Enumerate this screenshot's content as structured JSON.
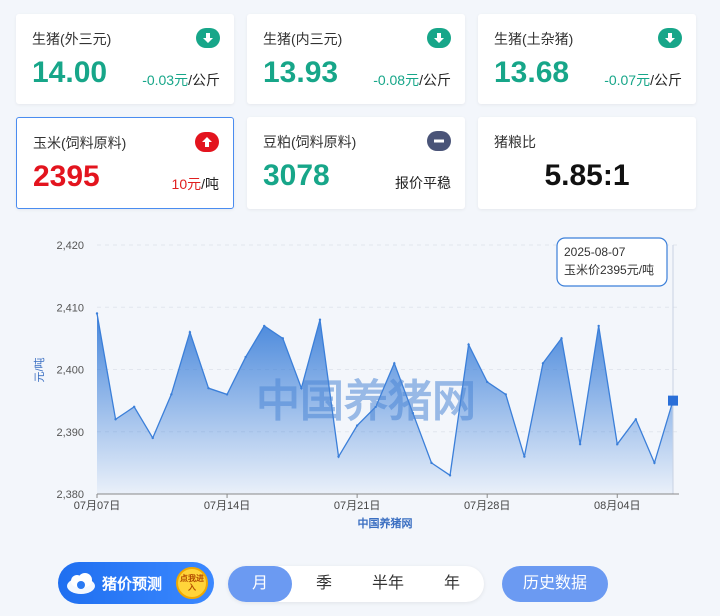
{
  "cards": [
    {
      "label": "生猪(外三元)",
      "value": "14.00",
      "change": "-0.03元",
      "unit": "/公斤",
      "trend": "down"
    },
    {
      "label": "生猪(内三元)",
      "value": "13.93",
      "change": "-0.08元",
      "unit": "/公斤",
      "trend": "down"
    },
    {
      "label": "生猪(土杂猪)",
      "value": "13.68",
      "change": "-0.07元",
      "unit": "/公斤",
      "trend": "down"
    },
    {
      "label": "玉米(饲料原料)",
      "value": "2395",
      "change": "10元",
      "unit": "/吨",
      "trend": "up"
    },
    {
      "label": "豆粕(饲料原料)",
      "value": "3078",
      "status": "报价平稳",
      "trend": "flat"
    },
    {
      "label": "猪粮比",
      "value": "5.85:1"
    }
  ],
  "chart_data": {
    "type": "area",
    "ylabel": "元/吨",
    "xlabel": "中国养猪网",
    "ylim": [
      2380,
      2420
    ],
    "yticks": [
      "2,380",
      "2,390",
      "2,400",
      "2,410",
      "2,420"
    ],
    "xticks": [
      "07月07日",
      "07月14日",
      "07月21日",
      "07月28日",
      "08月04日"
    ],
    "x": [
      "07-07",
      "07-08",
      "07-09",
      "07-10",
      "07-11",
      "07-12",
      "07-13",
      "07-14",
      "07-15",
      "07-16",
      "07-17",
      "07-18",
      "07-19",
      "07-20",
      "07-21",
      "07-22",
      "07-23",
      "07-24",
      "07-25",
      "07-26",
      "07-27",
      "07-28",
      "07-29",
      "07-30",
      "07-31",
      "08-01",
      "08-02",
      "08-03",
      "08-04",
      "08-05",
      "08-06",
      "08-07"
    ],
    "values": [
      2409,
      2392,
      2394,
      2389,
      2396,
      2406,
      2397,
      2396,
      2402,
      2407,
      2405,
      2397,
      2408,
      2386,
      2391,
      2394,
      2401,
      2393,
      2385,
      2383,
      2404,
      2398,
      2396,
      2386,
      2401,
      2405,
      2388,
      2407,
      2388,
      2392,
      2385,
      2395
    ],
    "watermark": "中国养猪网",
    "tooltip": {
      "date": "2025-08-07",
      "text": "玉米价2395元/吨"
    },
    "grid": true
  },
  "promo": {
    "label": "猪价预测",
    "coin": "点我进入"
  },
  "tabs": [
    "月",
    "季",
    "半年",
    "年"
  ],
  "active_tab": "月",
  "history_label": "历史数据",
  "colors": {
    "green": "#17a689",
    "red": "#e3141e",
    "accent": "#6b9af2",
    "line": "#3b7fd9"
  }
}
